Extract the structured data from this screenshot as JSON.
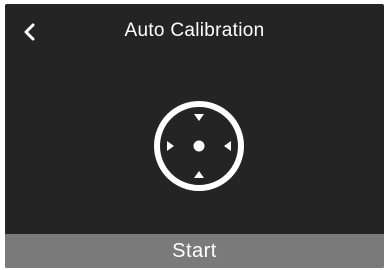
{
  "header": {
    "title": "Auto Calibration",
    "back_icon": "chevron-left-icon"
  },
  "calibration": {
    "icon": "crosshair-target-icon",
    "ring_color": "#ffffff"
  },
  "footer": {
    "start_label": "Start"
  },
  "colors": {
    "background": "#242424",
    "button": "#7a7a7a",
    "text": "#ffffff"
  }
}
